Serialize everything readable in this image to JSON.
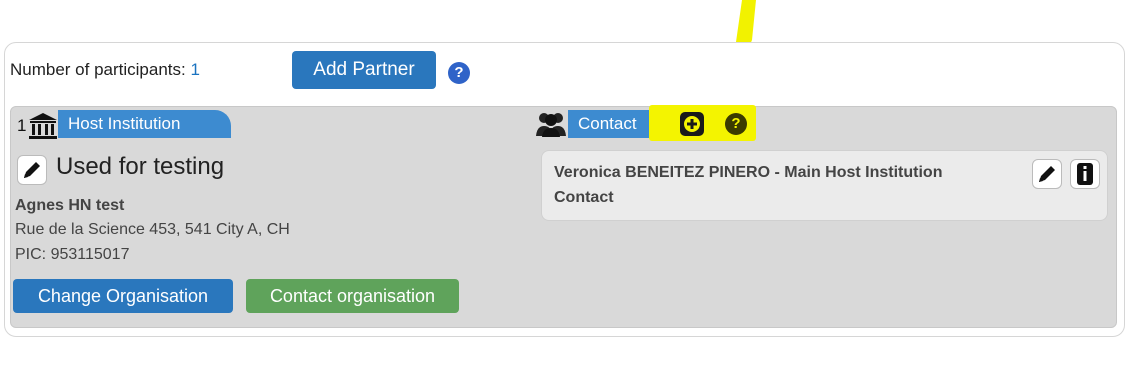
{
  "participants": {
    "label": "Number of participants:",
    "count": "1",
    "add_partner_label": "Add Partner",
    "help_glyph": "?"
  },
  "partner": {
    "number": "1",
    "role_label": "Host Institution",
    "org_title": "Used for testing",
    "org_name": "Agnes HN test",
    "address": "Rue de la Science 453, 541 City A, CH",
    "pic": "PIC: 953115017",
    "change_org_label": "Change Organisation",
    "contact_org_label": "Contact organisation"
  },
  "contact": {
    "label": "Contact",
    "help_glyph": "?",
    "entry_line1": "Veronica BENEITEZ PINERO - Main Host Institution",
    "entry_line2": "Contact"
  },
  "icons": [
    "help-icon",
    "institution-icon",
    "pencil-icon",
    "contacts-icon",
    "plus-icon",
    "info-icon",
    "arrow-annotation"
  ],
  "colors": {
    "primary_blue": "#2a77bd",
    "tag_blue": "#3d8bd0",
    "green": "#5fa35b",
    "annotation_yellow": "#f4f400",
    "help_blue": "#2f63c8"
  }
}
